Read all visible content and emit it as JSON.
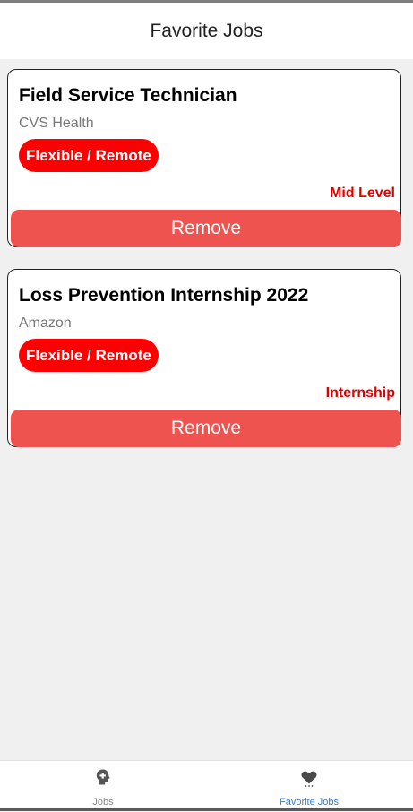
{
  "header": {
    "title": "Favorite Jobs"
  },
  "favorites": [
    {
      "title": "Field Service Technician",
      "company": "CVS Health",
      "badge": "Flexible / Remote",
      "level": "Mid Level",
      "remove_label": "Remove"
    },
    {
      "title": "Loss Prevention Internship 2022",
      "company": "Amazon",
      "badge": "Flexible / Remote",
      "level": "Internship",
      "remove_label": "Remove"
    }
  ],
  "tabs": [
    {
      "label": "Jobs",
      "icon": "head-plus-icon",
      "active": false
    },
    {
      "label": "Favorite Jobs",
      "icon": "heart-icon",
      "active": true
    }
  ],
  "colors": {
    "badge": "#ff0000",
    "level_text": "#e00000",
    "remove_button": "#ef5350",
    "active_tab": "#2f7fe0",
    "inactive_tab": "#8a8a8a"
  }
}
